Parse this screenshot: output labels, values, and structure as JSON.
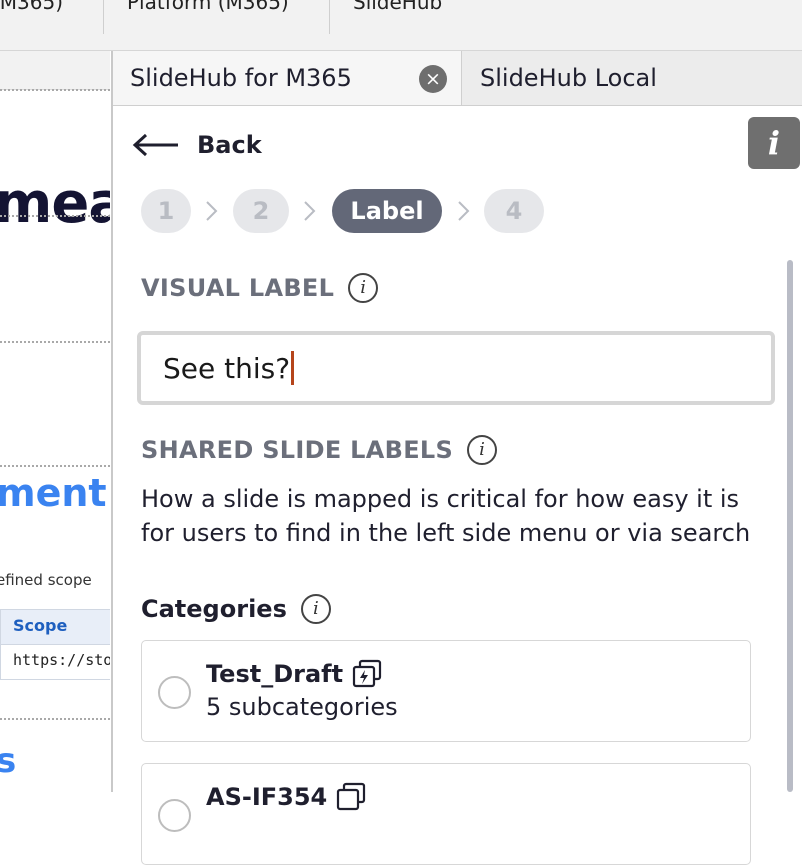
{
  "ribbon": {
    "tabs": [
      "(M365)",
      "Platform (M365)",
      "SlideHub"
    ]
  },
  "document": {
    "heading_fragment": "mea",
    "section_fragment": "ment",
    "scope_text": "efined scope",
    "table_header": "Scope",
    "table_cell": "https://sto",
    "footer_fragment": "s"
  },
  "pane": {
    "tabs": [
      {
        "label": "SlideHub for M365",
        "active": true
      },
      {
        "label": "SlideHub Local",
        "active": false
      }
    ],
    "close_icon": "×",
    "back_label": "Back",
    "info_icon": "i",
    "steps": [
      {
        "label": "1",
        "current": false
      },
      {
        "label": "2",
        "current": false
      },
      {
        "label": "Label",
        "current": true
      },
      {
        "label": "4",
        "current": false
      }
    ],
    "visual_label": {
      "heading": "VISUAL LABEL",
      "value": "See this?"
    },
    "shared_labels": {
      "heading": "SHARED SLIDE LABELS",
      "description": "How a slide is mapped is critical for how easy it is for users to find in the left side menu or via search"
    },
    "categories": {
      "heading": "Categories",
      "items": [
        {
          "title": "Test_Draft",
          "subtitle": "5 subcategories"
        },
        {
          "title": "AS-IF354",
          "subtitle": ""
        }
      ]
    }
  }
}
